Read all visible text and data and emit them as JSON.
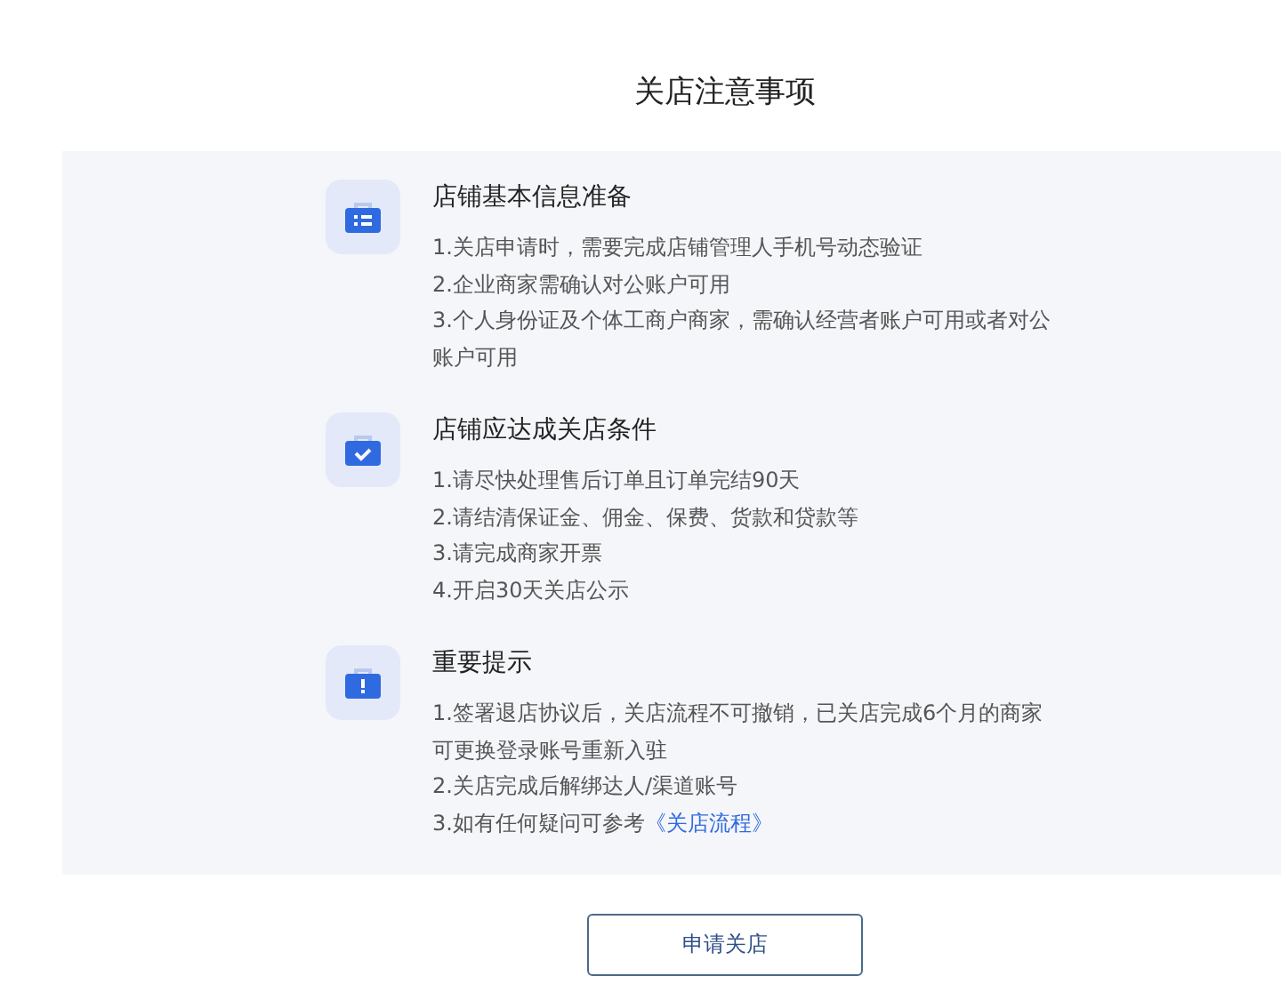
{
  "title": "关店注意事项",
  "sections": [
    {
      "kind": "list",
      "heading": "店铺基本信息准备",
      "items": [
        {
          "text": "1.关店申请时，需要完成店铺管理人手机号动态验证"
        },
        {
          "text": "2.企业商家需确认对公账户可用"
        },
        {
          "text": "3.个人身份证及个体工商户商家，需确认经营者账户可用或者对公账户可用"
        }
      ]
    },
    {
      "kind": "check",
      "heading": "店铺应达成关店条件",
      "items": [
        {
          "text": "1.请尽快处理售后订单且订单完结90天"
        },
        {
          "text": "2.请结清保证金、佣金、保费、货款和贷款等"
        },
        {
          "text": "3.请完成商家开票"
        },
        {
          "text": "4.开启30天关店公示"
        }
      ]
    },
    {
      "kind": "alert",
      "heading": "重要提示",
      "items": [
        {
          "text": "1.签署退店协议后，关店流程不可撤销，已关店完成6个月的商家可更换登录账号重新入驻"
        },
        {
          "text": "2.关店完成后解绑达人/渠道账号"
        },
        {
          "text": "3.如有任何疑问可参考",
          "link": "《关店流程》"
        }
      ]
    }
  ],
  "button": "申请关店"
}
